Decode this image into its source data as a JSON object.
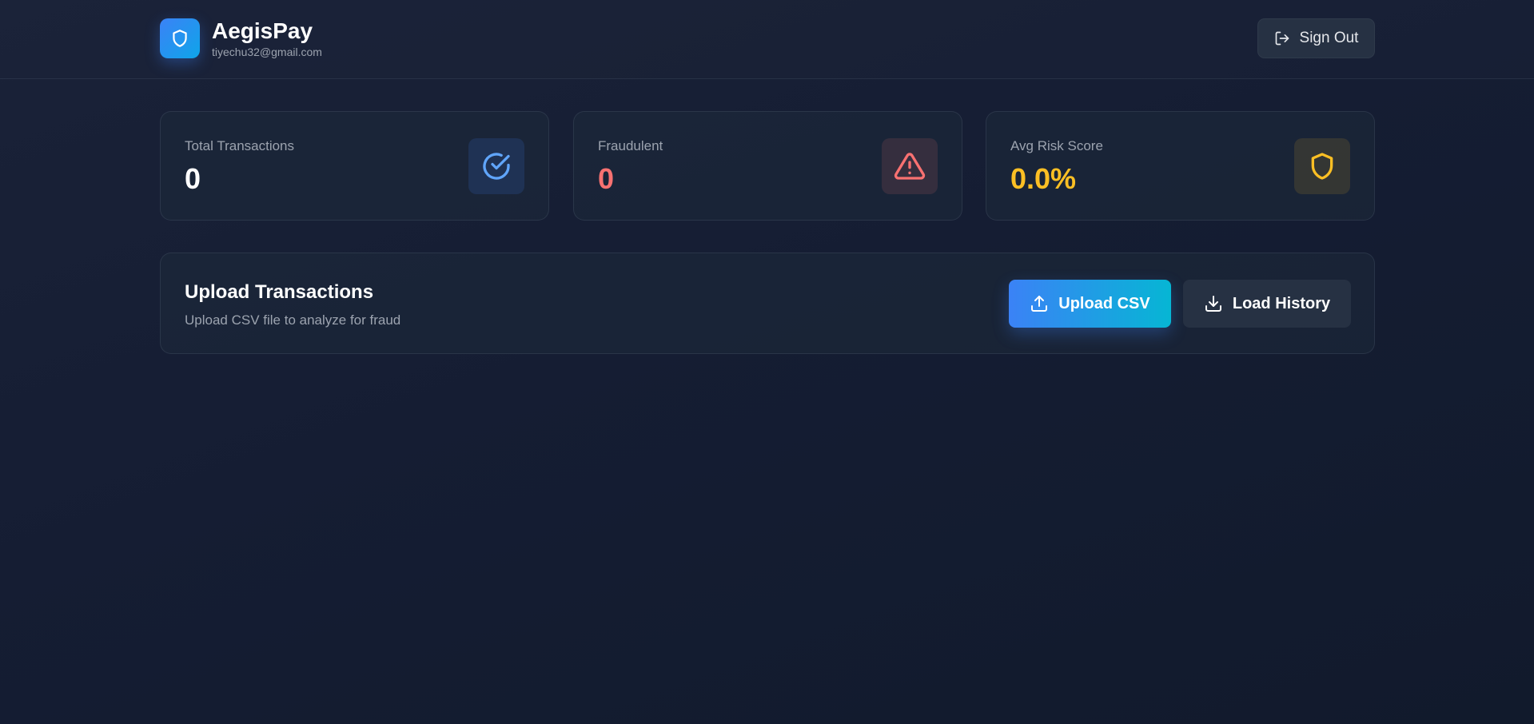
{
  "header": {
    "app_name": "AegisPay",
    "user_email": "tiyechu32@gmail.com",
    "logo_icon": "shield-icon",
    "signout_label": "Sign Out",
    "signout_icon": "log-out-icon"
  },
  "stats": [
    {
      "label": "Total Transactions",
      "value": "0",
      "icon": "check-circle-icon",
      "color": "#ffffff",
      "icon_color": "#60a5fa"
    },
    {
      "label": "Fraudulent",
      "value": "0",
      "icon": "alert-triangle-icon",
      "color": "#f87171",
      "icon_color": "#f87171"
    },
    {
      "label": "Avg Risk Score",
      "value": "0.0%",
      "icon": "shield-icon",
      "color": "#fbbf24",
      "icon_color": "#fbbf24"
    }
  ],
  "upload": {
    "title": "Upload Transactions",
    "subtitle": "Upload CSV file to analyze for fraud",
    "upload_button": "Upload CSV",
    "upload_icon": "upload-icon",
    "history_button": "Load History",
    "history_icon": "download-icon"
  },
  "colors": {
    "accent_blue": "#3b82f6",
    "accent_cyan": "#06b6d4",
    "danger": "#f87171",
    "warning": "#fbbf24"
  }
}
